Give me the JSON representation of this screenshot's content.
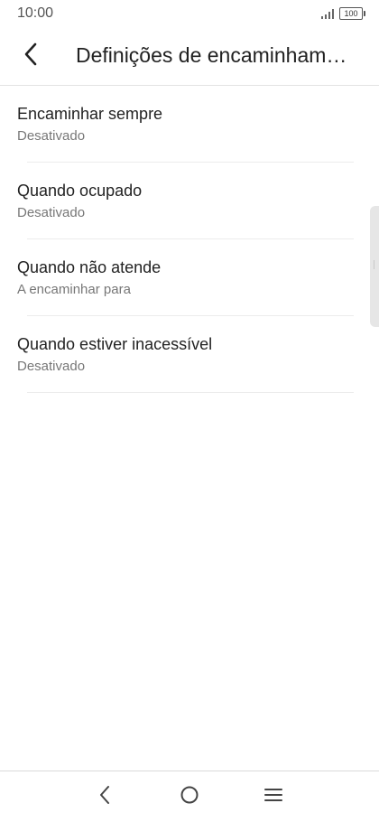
{
  "status_bar": {
    "time": "10:00",
    "battery": "100",
    "icons": [
      "signal-icon",
      "battery-icon"
    ]
  },
  "header": {
    "title": "Definições de encaminham…",
    "back_icon": "back-arrow-icon"
  },
  "settings": {
    "items": [
      {
        "title": "Encaminhar sempre",
        "subtitle": "Desativado"
      },
      {
        "title": "Quando ocupado",
        "subtitle": "Desativado"
      },
      {
        "title": "Quando não atende",
        "subtitle": "A encaminhar para"
      },
      {
        "title": "Quando estiver inacessível",
        "subtitle": "Desativado"
      }
    ]
  },
  "nav_bar": {
    "icons": [
      "nav-back-icon",
      "nav-home-icon",
      "nav-menu-icon"
    ]
  },
  "colors": {
    "background": "#ffffff",
    "title_text": "#222222",
    "subtitle_text": "#777777",
    "divider": "#ececec"
  }
}
